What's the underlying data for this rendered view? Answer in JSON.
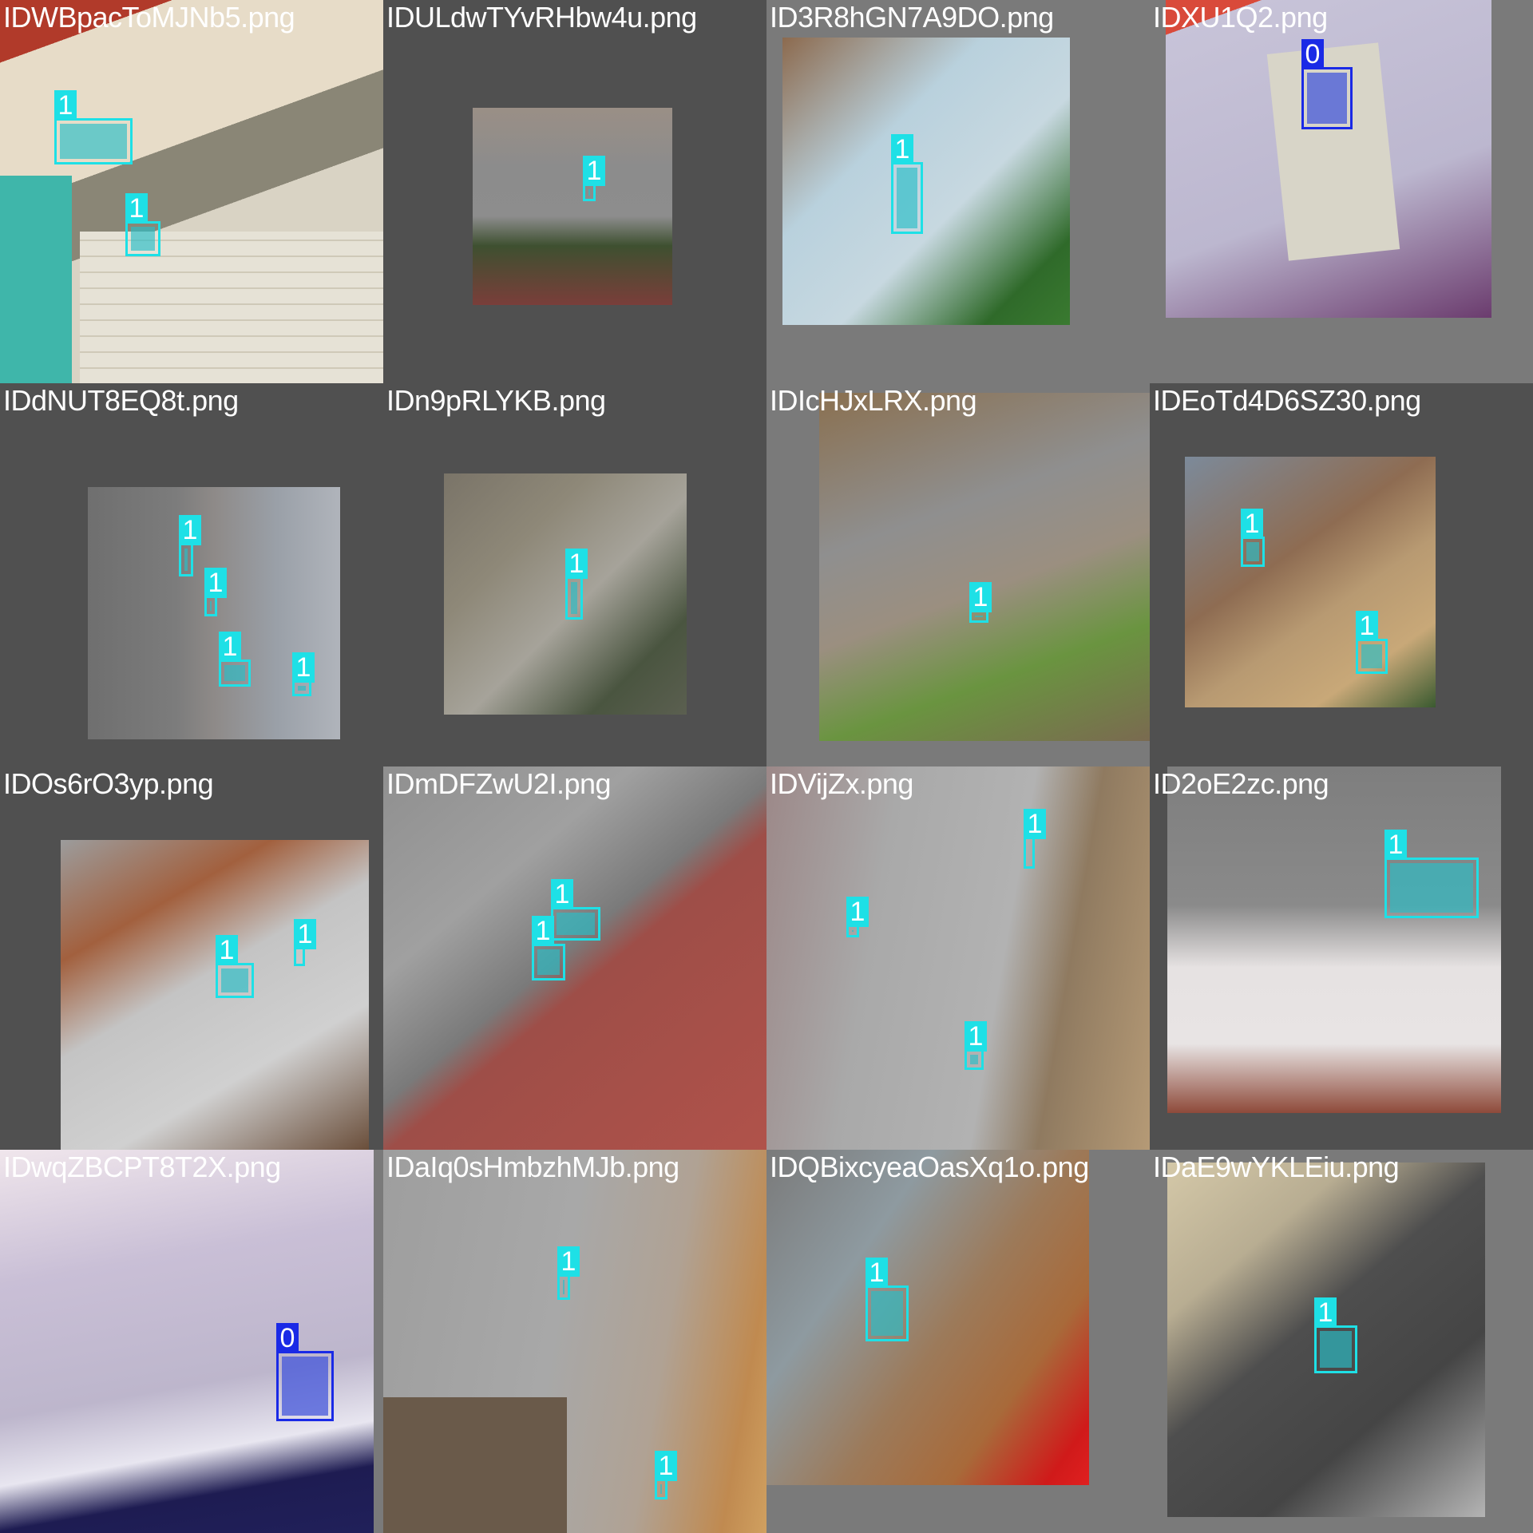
{
  "colors": {
    "class_1": "#1ee0e6",
    "class_0": "#1a2ae6",
    "padding_dark": "#505050",
    "padding_light": "#7a7a7a",
    "filename_text": "#ffffff"
  },
  "tiles": [
    {
      "filename": "IDWBpacToMJNb5.png",
      "detections": [
        {
          "label": "1"
        },
        {
          "label": "1"
        }
      ]
    },
    {
      "filename": "IDULdwTYvRHbw4u.png",
      "detections": [
        {
          "label": "1"
        }
      ]
    },
    {
      "filename": "ID3R8hGN7A9DO.png",
      "detections": [
        {
          "label": "1"
        }
      ]
    },
    {
      "filename": "IDXU1Q2.png",
      "detections": [
        {
          "label": "0"
        }
      ]
    },
    {
      "filename": "IDdNUT8EQ8t.png",
      "detections": [
        {
          "label": "1"
        },
        {
          "label": "1"
        },
        {
          "label": "1"
        },
        {
          "label": "1"
        }
      ]
    },
    {
      "filename": "IDn9pRLYKB.png",
      "detections": [
        {
          "label": "1"
        }
      ]
    },
    {
      "filename": "IDIcHJxLRX.png",
      "detections": [
        {
          "label": "1"
        }
      ]
    },
    {
      "filename": "IDEoTd4D6SZ30.png",
      "detections": [
        {
          "label": "1"
        },
        {
          "label": "1"
        }
      ]
    },
    {
      "filename": "IDOs6rO3yp.png",
      "detections": [
        {
          "label": "1"
        },
        {
          "label": "1"
        }
      ]
    },
    {
      "filename": "IDmDFZwU2I.png",
      "detections": [
        {
          "label": "1"
        },
        {
          "label": "1"
        }
      ]
    },
    {
      "filename": "IDVijZx.png",
      "detections": [
        {
          "label": "1"
        },
        {
          "label": "1"
        },
        {
          "label": "1"
        }
      ]
    },
    {
      "filename": "ID2oE2zc.png",
      "detections": [
        {
          "label": "1"
        }
      ]
    },
    {
      "filename": "IDwqZBCPT8T2X.png",
      "detections": [
        {
          "label": "0"
        }
      ]
    },
    {
      "filename": "IDaIq0sHmbzhMJb.png",
      "detections": [
        {
          "label": "1"
        },
        {
          "label": "1"
        }
      ]
    },
    {
      "filename": "IDQBixcyeaOasXq1o.png",
      "detections": [
        {
          "label": "1"
        }
      ]
    },
    {
      "filename": "IDaE9wYKLEiu.png",
      "detections": [
        {
          "label": "1"
        }
      ]
    }
  ]
}
